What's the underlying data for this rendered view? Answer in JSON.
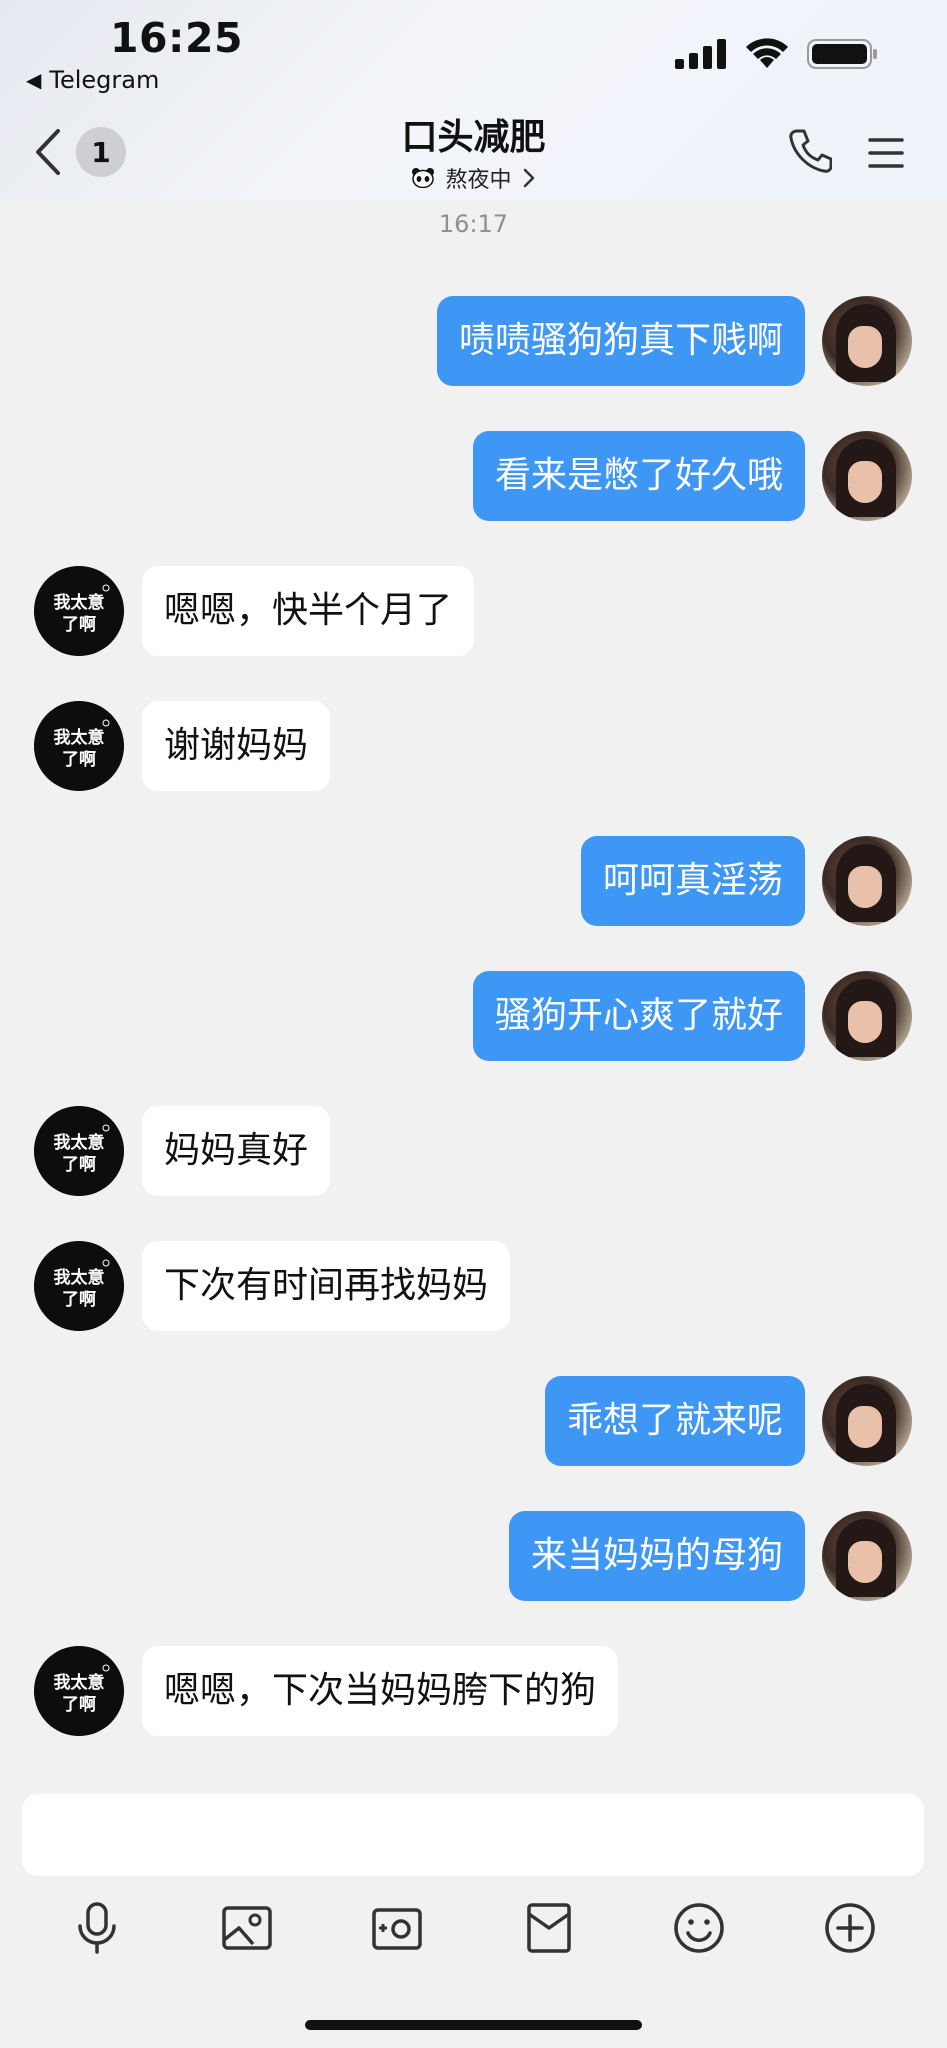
{
  "status_bar": {
    "time": "16:25",
    "back_app": "Telegram"
  },
  "header": {
    "unread_count": "1",
    "title": "口头减肥",
    "subtitle": "熬夜中"
  },
  "timestamp": "16:17",
  "avatar_logo_text": "我太意了啊",
  "messages": [
    {
      "side": "out",
      "text": "啧啧骚狗狗真下贱啊"
    },
    {
      "side": "out",
      "text": "看来是憋了好久哦"
    },
    {
      "side": "in",
      "text": "嗯嗯，快半个月了"
    },
    {
      "side": "in",
      "text": "谢谢妈妈"
    },
    {
      "side": "out",
      "text": "呵呵真淫荡"
    },
    {
      "side": "out",
      "text": "骚狗开心爽了就好"
    },
    {
      "side": "in",
      "text": "妈妈真好"
    },
    {
      "side": "in",
      "text": "下次有时间再找妈妈"
    },
    {
      "side": "out",
      "text": "乖想了就来呢"
    },
    {
      "side": "out",
      "text": "来当妈妈的母狗"
    },
    {
      "side": "in",
      "text": "嗯嗯，下次当妈妈胯下的狗"
    }
  ],
  "toolbar": [
    "microphone-icon",
    "image-icon",
    "camera-icon",
    "red-packet-icon",
    "emoji-icon",
    "plus-icon"
  ]
}
